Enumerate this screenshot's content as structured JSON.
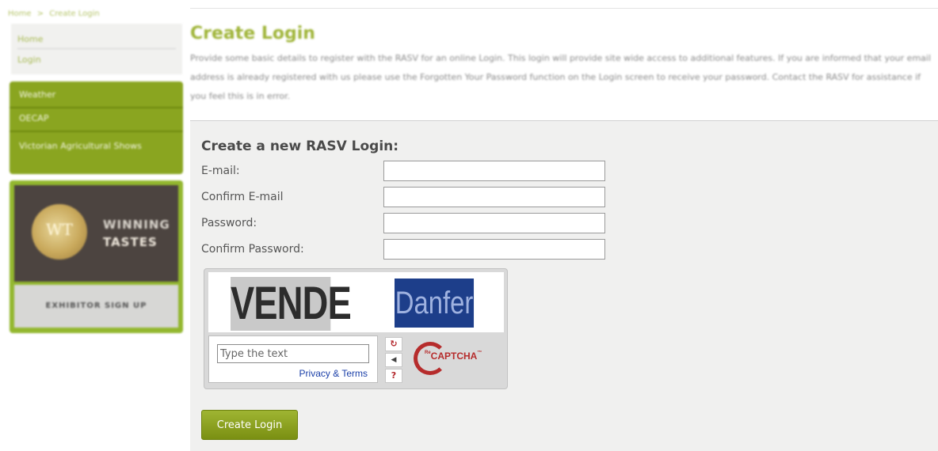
{
  "breadcrumb": [
    "Home",
    ">",
    "Create Login"
  ],
  "sidebar": {
    "links": [
      {
        "label": "Home"
      },
      {
        "label": "Login"
      }
    ],
    "menu": [
      {
        "label": "Weather"
      },
      {
        "label": "OECAP"
      },
      {
        "label": "Victorian Agricultural Shows"
      }
    ],
    "promo": {
      "logo_text": "WT",
      "title_line1": "WINNING",
      "title_line2": "TASTES",
      "button_label": "EXHIBITOR SIGN UP"
    }
  },
  "page": {
    "title": "Create Login",
    "intro": "Provide some basic details to register with the RASV for an online Login. This login will provide site wide access to additional features. If you are informed that your email address is already registered with us please use the Forgotten Your Password function on the Login screen to receive your password. Contact the RASV for assistance if you feel this is in error."
  },
  "form": {
    "heading": "Create a new RASV Login:",
    "fields": [
      {
        "label": "E-mail:",
        "value": ""
      },
      {
        "label": "Confirm E-mail",
        "value": ""
      },
      {
        "label": "Password:",
        "value": ""
      },
      {
        "label": "Confirm Password:",
        "value": ""
      }
    ],
    "submit_label": "Create Login"
  },
  "captcha": {
    "word1": "VENDE",
    "word2": "Danfer",
    "input_placeholder": "Type the text",
    "privacy_label": "Privacy & Terms",
    "brand_prefix": "Re",
    "brand": "CAPTCHA",
    "brand_tm": "™",
    "controls": {
      "reload_icon": "↻",
      "audio_icon": "◀︎",
      "help_icon": "?"
    }
  },
  "colors": {
    "accent_green": "#8aa520",
    "title_green": "#a0b53a",
    "captcha_red": "#b62c2c",
    "link_blue": "#1a3fa8"
  }
}
